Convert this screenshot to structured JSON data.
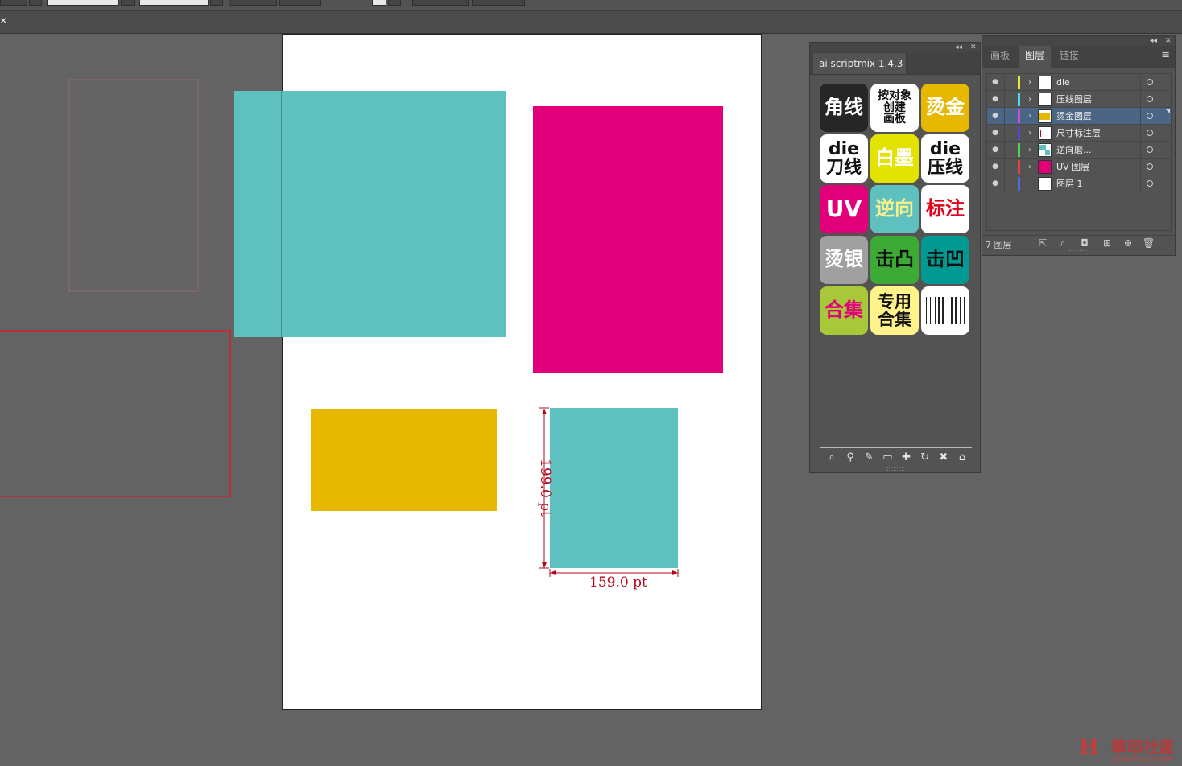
{
  "dimensions": {
    "height_label": "199.0 pt",
    "width_label": "159.0 pt",
    "color": "#b2071d"
  },
  "colors": {
    "teal": "#5fc1bf",
    "magenta": "#e2007a",
    "yellow": "#e6b800",
    "selection": "#4b6584"
  },
  "script_panel": {
    "tab_label": "ai scriptmix 1.4.3",
    "buttons": [
      {
        "label": "角线",
        "bg": "#262626",
        "fg": "#ffffff",
        "size": "24px"
      },
      {
        "label": "按对象\n创建\n画板",
        "bg": "#ffffff",
        "fg": "#111111",
        "size": "14px"
      },
      {
        "label": "烫金",
        "bg": "#e6b800",
        "fg": "#ffffff",
        "size": "24px"
      },
      {
        "label": "die\n刀线",
        "bg": "#ffffff",
        "fg": "#111111",
        "size": "22px"
      },
      {
        "label": "白墨",
        "bg": "#e3e300",
        "fg": "#ffffff",
        "size": "24px"
      },
      {
        "label": "die\n压线",
        "bg": "#ffffff",
        "fg": "#111111",
        "size": "22px"
      },
      {
        "label": "UV",
        "bg": "#e2007a",
        "fg": "#ffffff",
        "size": "28px"
      },
      {
        "label": "逆向",
        "bg": "#5fc1bf",
        "fg": "#f5f08a",
        "size": "24px"
      },
      {
        "label": "标注",
        "bg": "#ffffff",
        "fg": "#e2001a",
        "size": "24px"
      },
      {
        "label": "烫银",
        "bg": "#a0a0a0",
        "fg": "#ffffff",
        "size": "24px"
      },
      {
        "label": "击凸",
        "bg": "#3daa35",
        "fg": "#111111",
        "size": "24px"
      },
      {
        "label": "击凹",
        "bg": "#009a93",
        "fg": "#111111",
        "size": "24px"
      },
      {
        "label": "合集",
        "bg": "#a8c83a",
        "fg": "#e2007a",
        "size": "24px"
      },
      {
        "label": "专用\n合集",
        "bg": "#fff38a",
        "fg": "#111111",
        "size": "21px"
      },
      {
        "label": "",
        "bg": "#ffffff",
        "fg": "#111111",
        "size": "12px",
        "icon": "barcode-icon"
      }
    ],
    "footer_icons": [
      "search-icon",
      "search-user-icon",
      "wrench-icon",
      "folder-icon",
      "plus-icon",
      "refresh-icon",
      "close-icon",
      "home-icon"
    ]
  },
  "layers_panel": {
    "tabs": [
      "画板",
      "图层",
      "链接"
    ],
    "active_tab": 1,
    "layers": [
      {
        "name": "die",
        "color": "#e8e835",
        "arrow": "›",
        "thumb": "white",
        "selected": false
      },
      {
        "name": "压线图层",
        "color": "#4bd8f0",
        "arrow": "›",
        "thumb": "white",
        "selected": false
      },
      {
        "name": "烫金图层",
        "color": "#d24adc",
        "arrow": "›",
        "thumb": "yellow",
        "selected": true
      },
      {
        "name": "尺寸标注层",
        "color": "#5546d2",
        "arrow": "›",
        "thumb": "dim",
        "selected": false
      },
      {
        "name": "逆向磨...",
        "color": "#4fd64f",
        "arrow": "›",
        "thumb": "teal",
        "selected": false
      },
      {
        "name": "UV 图层",
        "color": "#e04444",
        "arrow": "›",
        "thumb": "magenta",
        "selected": false
      },
      {
        "name": "图层 1",
        "color": "#4a6ee0",
        "arrow": "",
        "thumb": "white",
        "selected": false
      }
    ],
    "count_label": "7 图层"
  },
  "watermark": {
    "mark": "H",
    "text": "華印社區",
    "url": "www.52cnp.com"
  }
}
